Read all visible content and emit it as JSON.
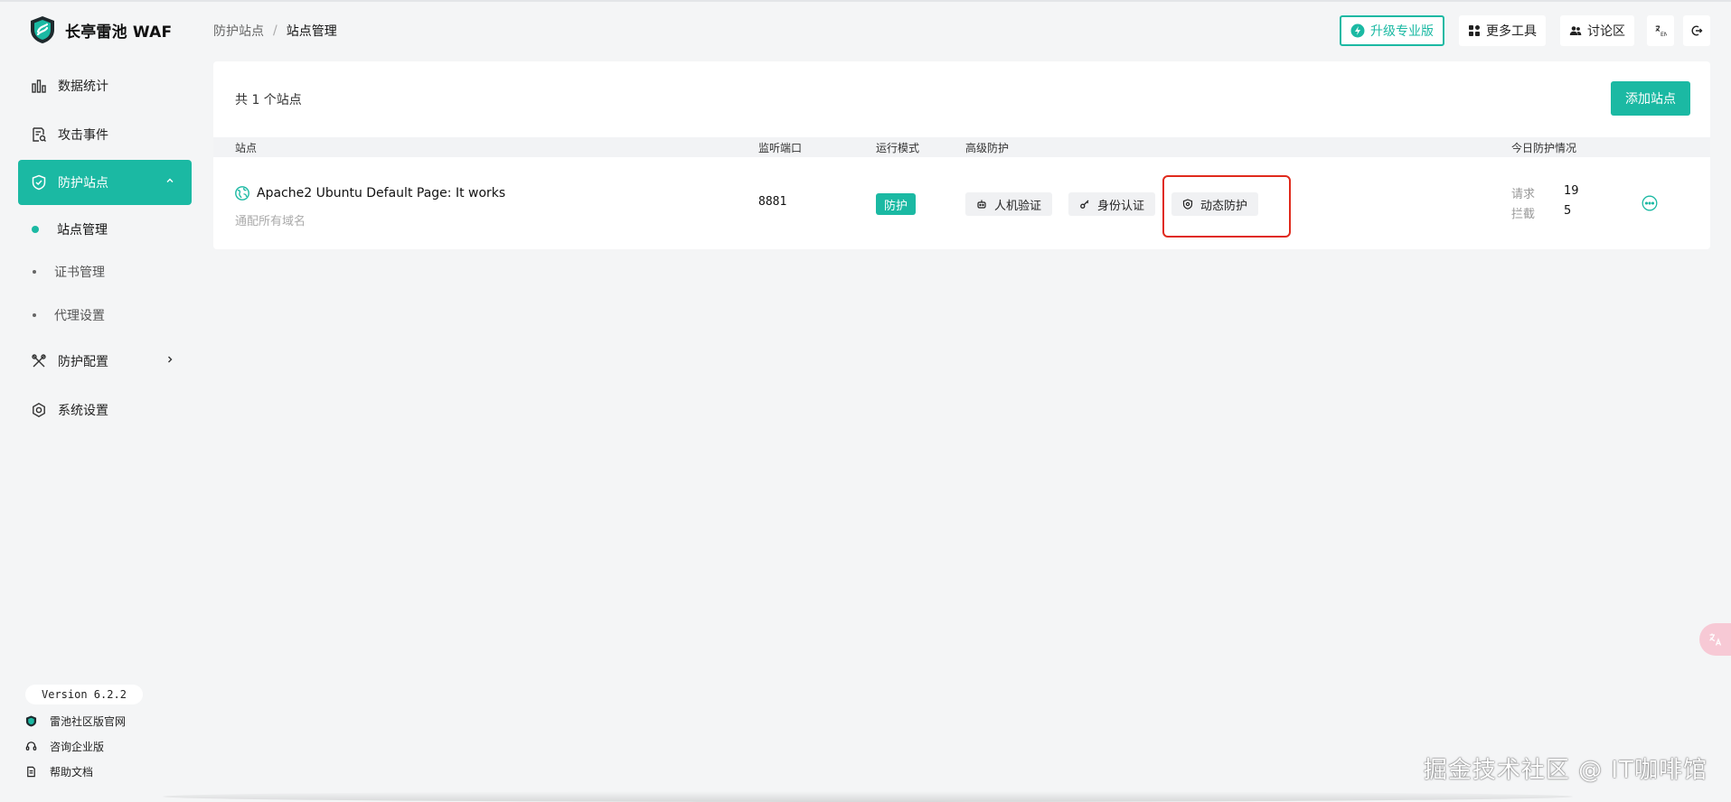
{
  "brand": {
    "name": "长亭雷池 WAF"
  },
  "sidebar": {
    "items": [
      {
        "label": "数据统计"
      },
      {
        "label": "攻击事件"
      },
      {
        "label": "防护站点"
      },
      {
        "label": "防护配置"
      },
      {
        "label": "系统设置"
      }
    ],
    "sub_items": [
      {
        "label": "站点管理"
      },
      {
        "label": "证书管理"
      },
      {
        "label": "代理设置"
      }
    ],
    "version": "Version 6.2.2",
    "footer": [
      {
        "label": "雷池社区版官网"
      },
      {
        "label": "咨询企业版"
      },
      {
        "label": "帮助文档"
      }
    ]
  },
  "breadcrumb": {
    "parent": "防护站点",
    "separator": "/",
    "current": "站点管理"
  },
  "header": {
    "upgrade": "升级专业版",
    "more_tools": "更多工具",
    "discussion": "讨论区"
  },
  "sites": {
    "count_label": "共 1 个站点",
    "add_button": "添加站点",
    "columns": {
      "site": "站点",
      "port": "监听端口",
      "mode": "运行模式",
      "advanced": "高级防护",
      "today": "今日防护情况"
    },
    "rows": [
      {
        "name": "Apache2 Ubuntu Default Page: It works",
        "domain": "通配所有域名",
        "port": "8881",
        "mode": "防护",
        "protections": [
          "人机验证",
          "身份认证",
          "动态防护"
        ],
        "stats": [
          {
            "label": "请求",
            "value": "19"
          },
          {
            "label": "拦截",
            "value": "5"
          }
        ]
      }
    ]
  },
  "watermark": "掘金技术社区 @ IT咖啡馆",
  "colors": {
    "accent": "#1bb9a3",
    "highlight": "#e02a1c"
  }
}
